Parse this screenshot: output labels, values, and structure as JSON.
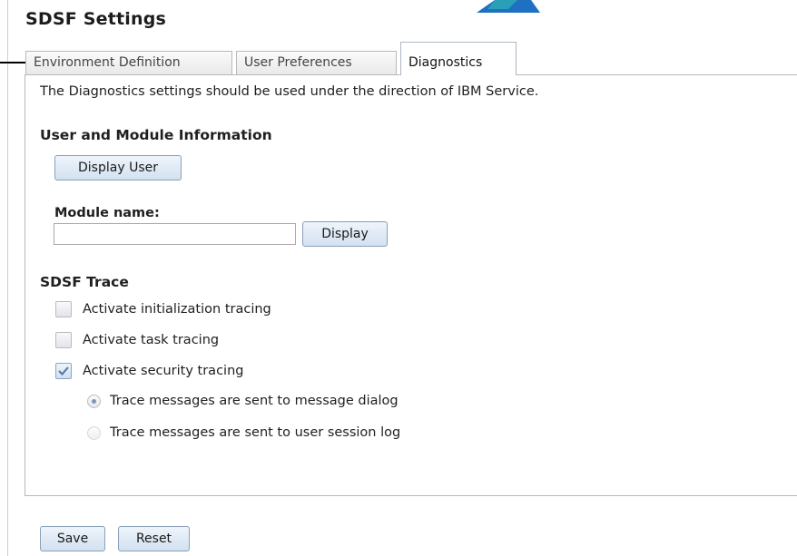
{
  "page": {
    "title": "SDSF Settings"
  },
  "tabs": [
    {
      "label": "Environment Definition"
    },
    {
      "label": "User Preferences"
    },
    {
      "label": "Diagnostics",
      "active": true
    }
  ],
  "diagnostics": {
    "note": "The Diagnostics settings should be used under the direction of IBM Service.",
    "user_module": {
      "heading": "User and Module Information",
      "display_user_button": "Display User",
      "module_label": "Module name:",
      "module_value": "",
      "display_button": "Display"
    },
    "trace": {
      "heading": "SDSF Trace",
      "checkboxes": [
        {
          "label": "Activate initialization tracing",
          "checked": false
        },
        {
          "label": "Activate task tracing",
          "checked": false
        },
        {
          "label": "Activate security tracing",
          "checked": true
        }
      ],
      "radios": [
        {
          "label": "Trace messages are sent to message dialog",
          "selected": true
        },
        {
          "label": "Trace messages are sent to user session log",
          "selected": false
        }
      ]
    }
  },
  "footer": {
    "save_label": "Save",
    "reset_label": "Reset"
  },
  "colors": {
    "button_border": "#8aa0b8",
    "button_fill": "#dbe6f3",
    "brand_blue": "#1f70c1"
  },
  "icons": {
    "check": "checkmark-icon",
    "logo": "ibm-logo-icon"
  }
}
